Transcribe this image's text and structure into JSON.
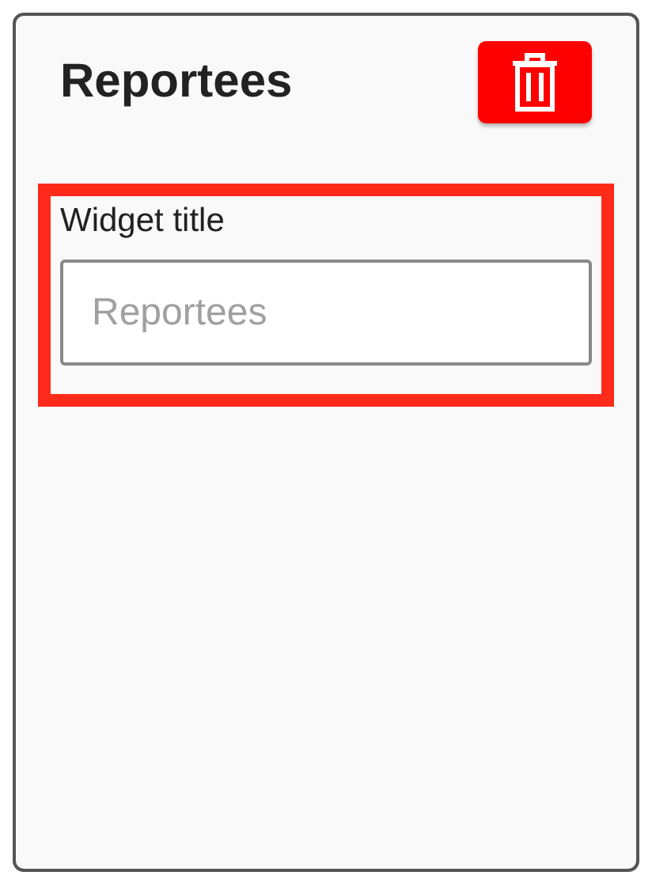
{
  "widget": {
    "title": "Reportees"
  },
  "field": {
    "label": "Widget title",
    "placeholder": "Reportees",
    "highlighted": true
  }
}
